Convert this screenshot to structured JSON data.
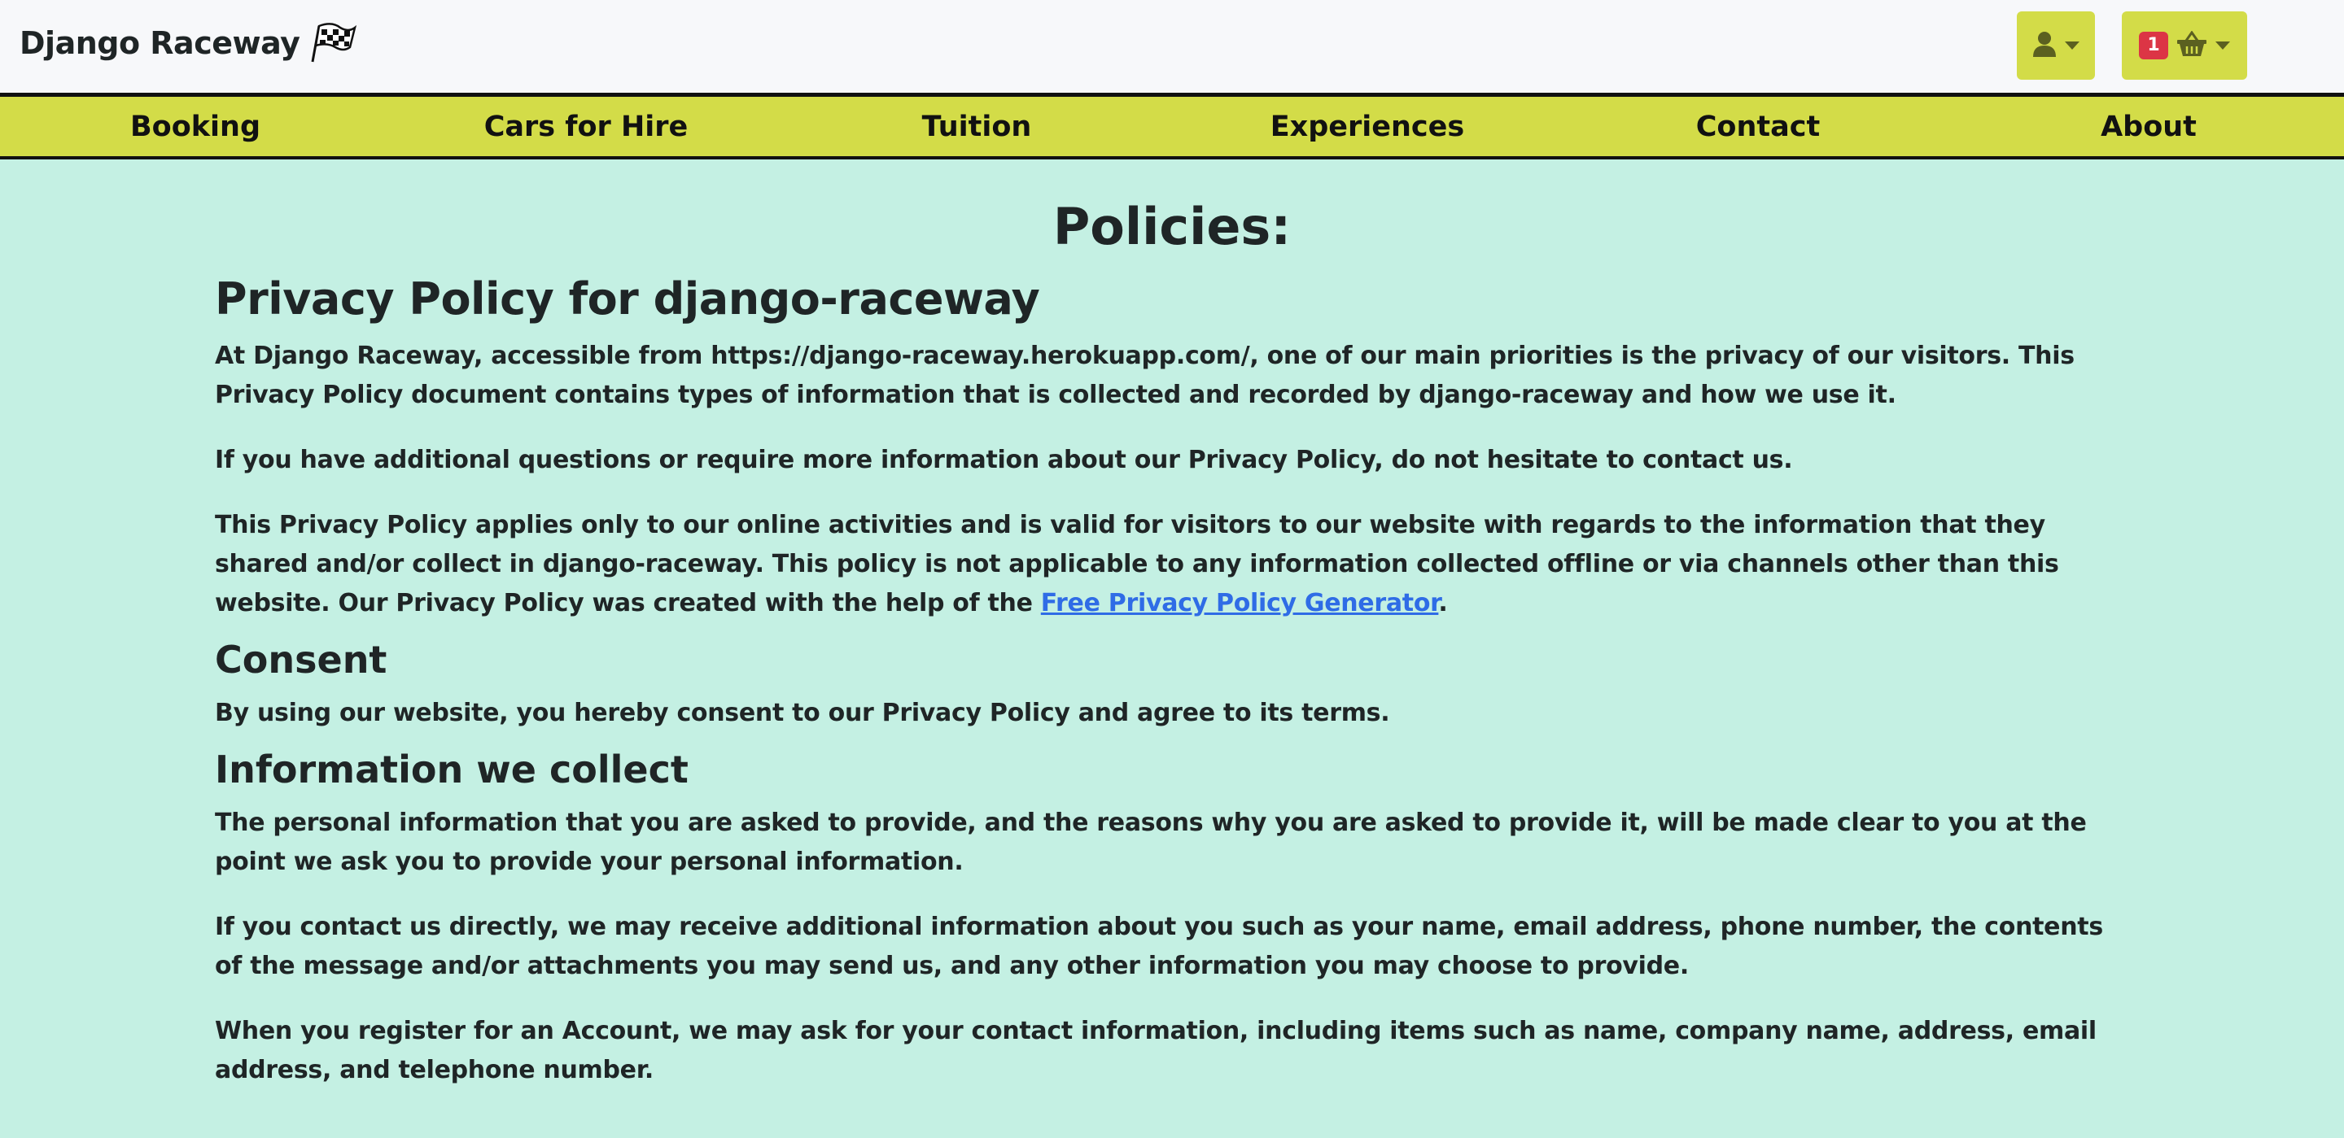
{
  "brand": {
    "name": "Django Raceway",
    "icon": "checkered-flag-icon"
  },
  "header": {
    "account_icon": "user-icon",
    "basket_icon": "basket-icon",
    "basket_count": "1",
    "badge_color": "#dc3545",
    "accent_color": "#d3dc48"
  },
  "nav": {
    "items": [
      {
        "label": "Booking"
      },
      {
        "label": "Cars for Hire"
      },
      {
        "label": "Tuition"
      },
      {
        "label": "Experiences"
      },
      {
        "label": "Contact"
      },
      {
        "label": "About"
      }
    ]
  },
  "page": {
    "title": "Policies:",
    "heading": "Privacy Policy for django-raceway",
    "intro_p1": "At Django Raceway, accessible from https://django-raceway.herokuapp.com/, one of our main priorities is the privacy of our visitors. This Privacy Policy document contains types of information that is collected and recorded by django-raceway and how we use it.",
    "intro_p2": "If you have additional questions or require more information about our Privacy Policy, do not hesitate to contact us.",
    "intro_p3_before": "This Privacy Policy applies only to our online activities and is valid for visitors to our website with regards to the information that they shared and/or collect in django-raceway. This policy is not applicable to any information collected offline or via channels other than this website. Our Privacy Policy was created with the help of the ",
    "intro_p3_link": "Free Privacy Policy Generator",
    "intro_p3_after": ".",
    "consent_heading": "Consent",
    "consent_p": "By using our website, you hereby consent to our Privacy Policy and agree to its terms.",
    "info_heading": "Information we collect",
    "info_p1": "The personal information that you are asked to provide, and the reasons why you are asked to provide it, will be made clear to you at the point we ask you to provide your personal information.",
    "info_p2": "If you contact us directly, we may receive additional information about you such as your name, email address, phone number, the contents of the message and/or attachments you may send us, and any other information you may choose to provide.",
    "info_p3": "When you register for an Account, we may ask for your contact information, including items such as name, company name, address, email address, and telephone number."
  }
}
